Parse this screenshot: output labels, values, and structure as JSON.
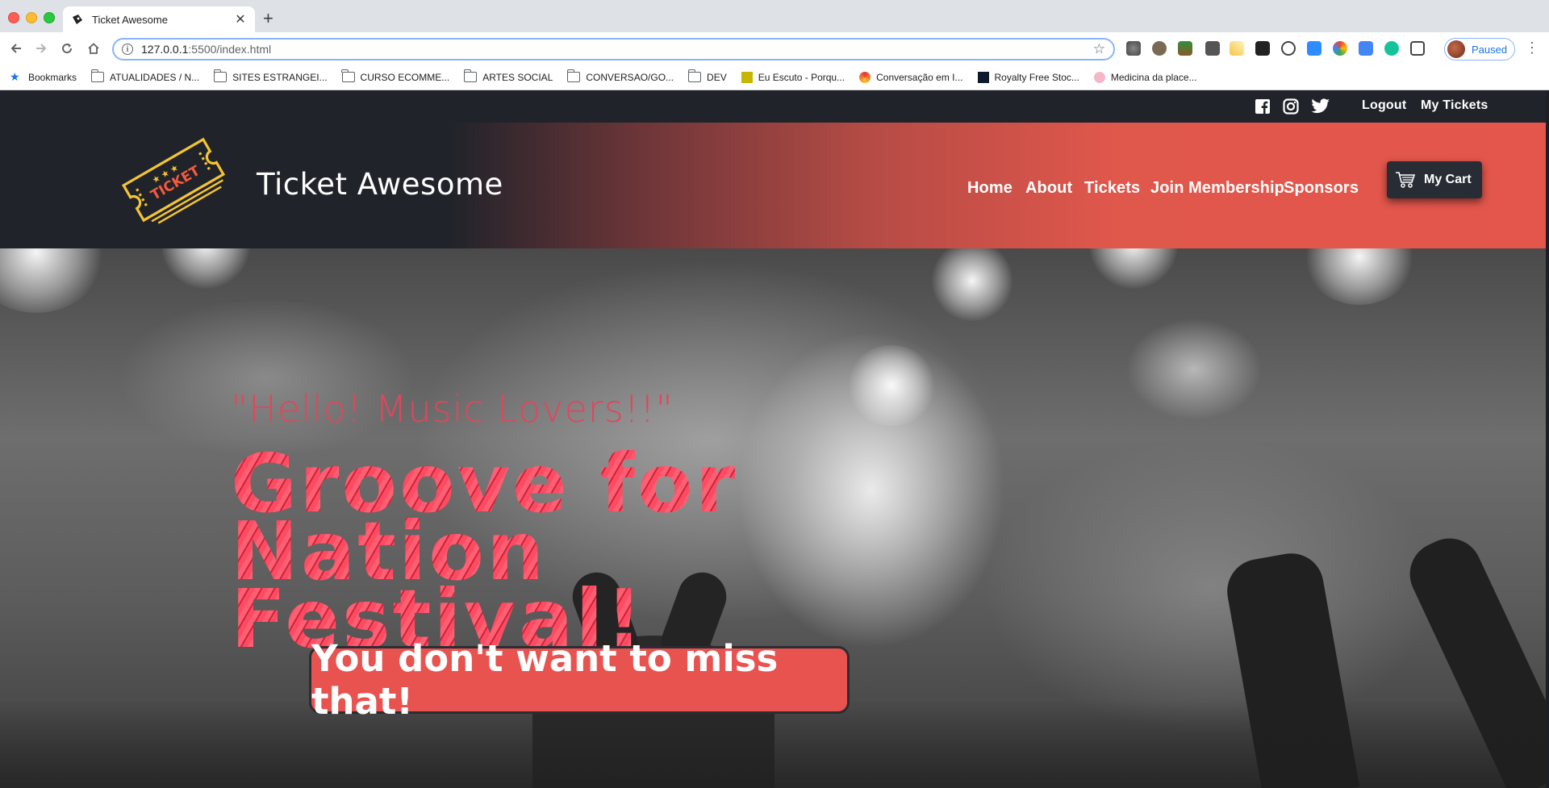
{
  "browser": {
    "tab_title": "Ticket Awesome",
    "url_host": "127.0.0.1",
    "url_rest": ":5500/index.html",
    "profile_label": "Paused",
    "bookmarks": [
      {
        "label": "Bookmarks",
        "icon": "star-icon"
      },
      {
        "label": "ATUALIDADES / N...",
        "icon": "folder-icon"
      },
      {
        "label": "SITES ESTRANGEI...",
        "icon": "folder-icon"
      },
      {
        "label": "CURSO ECOMME...",
        "icon": "folder-icon"
      },
      {
        "label": "ARTES SOCIAL",
        "icon": "folder-icon"
      },
      {
        "label": "CONVERSAO/GO...",
        "icon": "folder-icon"
      },
      {
        "label": "DEV",
        "icon": "folder-icon"
      },
      {
        "label": "Eu Escuto - Porqu...",
        "icon": "site-icon"
      },
      {
        "label": "Conversação em I...",
        "icon": "site-icon"
      },
      {
        "label": "Royalty Free Stoc...",
        "icon": "site-icon"
      },
      {
        "label": "Medicina da place...",
        "icon": "site-icon"
      }
    ]
  },
  "site": {
    "top_links": {
      "logout": "Logout",
      "my_tickets": "My Tickets"
    },
    "brand": "Ticket Awesome",
    "logo_text": "TICKET",
    "nav": {
      "home": "Home",
      "about": "About",
      "tickets": "Tickets",
      "membership": "Join Membership",
      "sponsors": "Sponsors"
    },
    "cart_label": "My Cart",
    "hero": {
      "subtitle": "\"Hello! Music Lovers!!\"",
      "title_line1": "Groove for Nation",
      "title_line2": "Festival!",
      "cta": "You don't want to miss that!"
    }
  },
  "colors": {
    "accent": "#e4564c",
    "dark": "#20232a",
    "hero_text": "#f04b5e"
  }
}
